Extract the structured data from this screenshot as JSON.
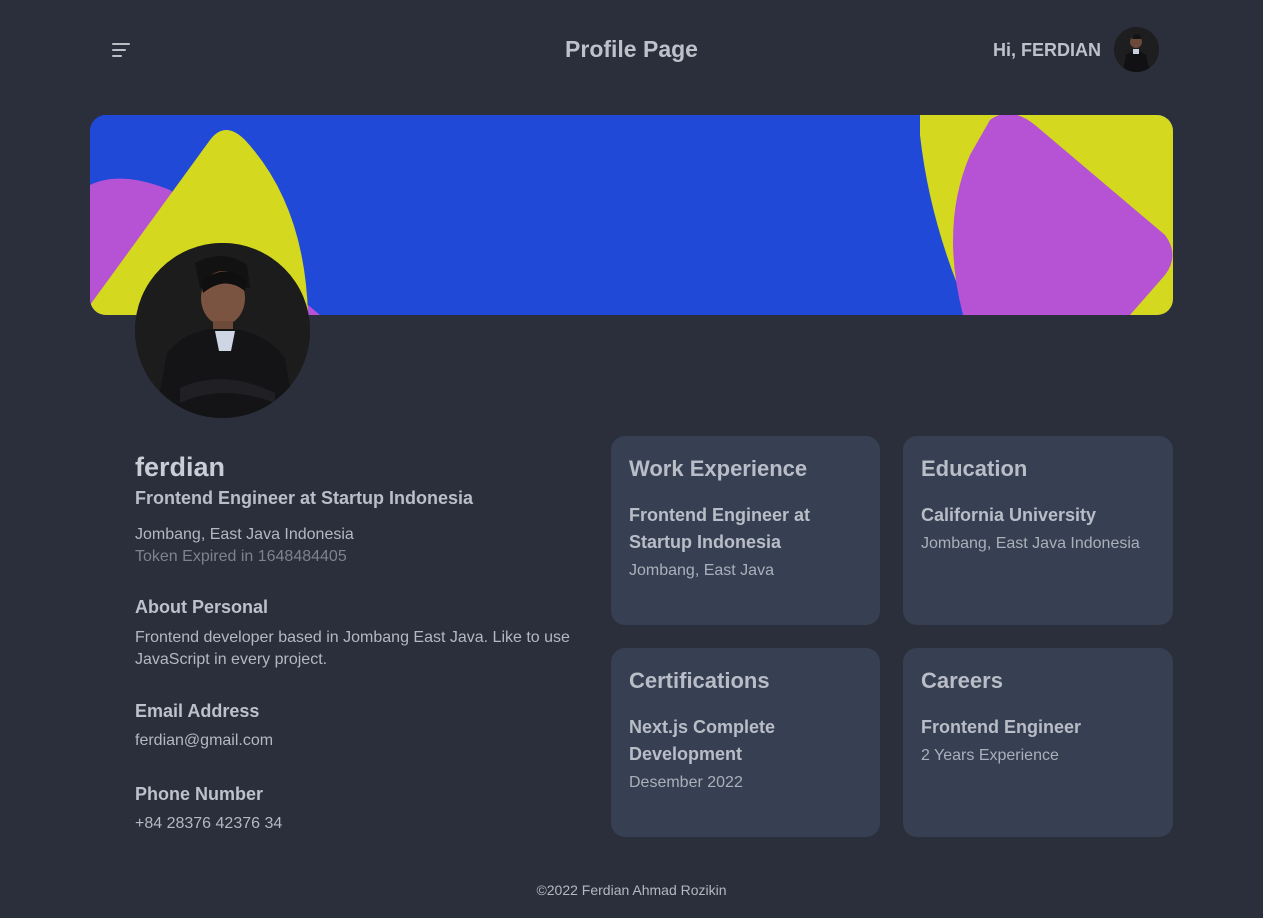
{
  "header": {
    "menu_icon": "menu-icon",
    "title": "Profile Page",
    "greeting": "Hi, FERDIAN",
    "avatar_icon": "user-avatar"
  },
  "banner": {
    "colors": {
      "background": "#2149d8",
      "yellow": "#d4d81f",
      "purple": "#b652d4"
    }
  },
  "profile": {
    "name": "ferdian",
    "role": "Frontend Engineer at Startup Indonesia",
    "location": "Jombang, East Java Indonesia",
    "token": "Token Expired in 1648484405",
    "about_title": "About Personal",
    "about_text": "Frontend developer based in Jombang East Java. Like to use JavaScript in every project.",
    "email_title": "Email Address",
    "email": "ferdian@gmail.com",
    "phone_title": "Phone Number",
    "phone": "+84 28376 42376 34"
  },
  "cards": {
    "work": {
      "title": "Work Experience",
      "main": "Frontend Engineer at Startup Indonesia",
      "sub": "Jombang, East Java"
    },
    "education": {
      "title": "Education",
      "main": "California University",
      "sub": "Jombang, East Java Indonesia"
    },
    "certifications": {
      "title": "Certifications",
      "main": "Next.js Complete Development",
      "sub": "Desember 2022"
    },
    "careers": {
      "title": "Careers",
      "main": "Frontend Engineer",
      "sub": "2 Years Experience"
    }
  },
  "footer": {
    "text": "©2022 Ferdian Ahmad Rozikin"
  }
}
